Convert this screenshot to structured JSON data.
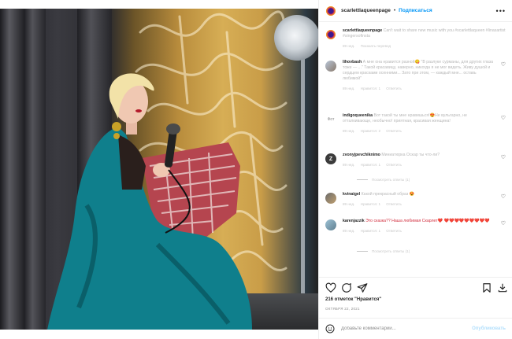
{
  "post": {
    "username": "scarlettlaqueenpage",
    "follow_label": "Подписаться",
    "more_icon": "more-horizontal-icon",
    "caption_username": "scarlettlaqueenpage",
    "caption_text": "Can't wait to share new music with you #scarlettlaqueen #linasartist #singersofinsta",
    "caption_time": "89 нед.",
    "caption_translate": "Показать перевод"
  },
  "comments": [
    {
      "username": "lihovbash",
      "text": "А мне она нравится разной😋 \"В разлуке сурманы, для других глаза тоже — ...\" Такой красавицу, наверно, никогда я не мог видеть. Живу душой и сердцем красками осенними... Зато при этом, — каждый мне... оставь любимой\"",
      "time": "89 нед.",
      "likes": "Нравится: 1",
      "reply": "Ответить",
      "heart_icon": "heart-outline-icon"
    },
    {
      "username": "indigoqueenika",
      "avatar_text": "Фот",
      "text": "Вот такой ты мне нравишься!😍Не вульгарно, не отталкивающе, необычно! приятная, красивая женщина!",
      "time": "89 нед.",
      "likes": "Нравится: 2",
      "reply": "Ответить",
      "heart_icon": "heart-outline-icon"
    },
    {
      "username": "zvonyjpevchiknimo",
      "avatar_text": "Z",
      "text": "Миниатюрка Оскар ты что-ли?",
      "time": "89 нед.",
      "likes": "Нравится: 1",
      "reply": "Ответить",
      "replies_label": "Посмотреть ответы (1)",
      "heart_icon": "heart-outline-icon"
    },
    {
      "username": "kvinaigel",
      "text": "Какой прекрасный образ 😍",
      "time": "89 нед.",
      "likes": "Нравится: 1",
      "reply": "Ответить",
      "heart_icon": "heart-outline-icon"
    },
    {
      "username": "karenjazzik",
      "text": "Это сказка?? Наша любимая Скарлет❤️ ❤️❤️❤️❤️❤️❤️❤️❤️❤️",
      "time": "89 нед.",
      "likes": "Нравится: 1",
      "reply": "Ответить",
      "replies_label": "Посмотреть ответы (1)",
      "heart_icon": "heart-outline-icon"
    }
  ],
  "actions": {
    "like_icon": "heart-outline-icon",
    "comment_icon": "comment-bubble-icon",
    "share_icon": "send-paper-plane-icon",
    "save_icon": "bookmark-icon",
    "download_icon": "download-icon"
  },
  "likes_count": "216 отметок \"Нравится\"",
  "post_date": "ОКТЯБРЯ 22, 2021",
  "add_comment": {
    "emoji_icon": "emoji-smile-icon",
    "placeholder": "Добавьте комментарий...",
    "post_label": "Опубликовать"
  },
  "colors": {
    "accent": "#0095f6",
    "post_disabled": "#b2dffc",
    "teal_dress": "#0f7f8c",
    "gold_wall": "#c99d48"
  }
}
